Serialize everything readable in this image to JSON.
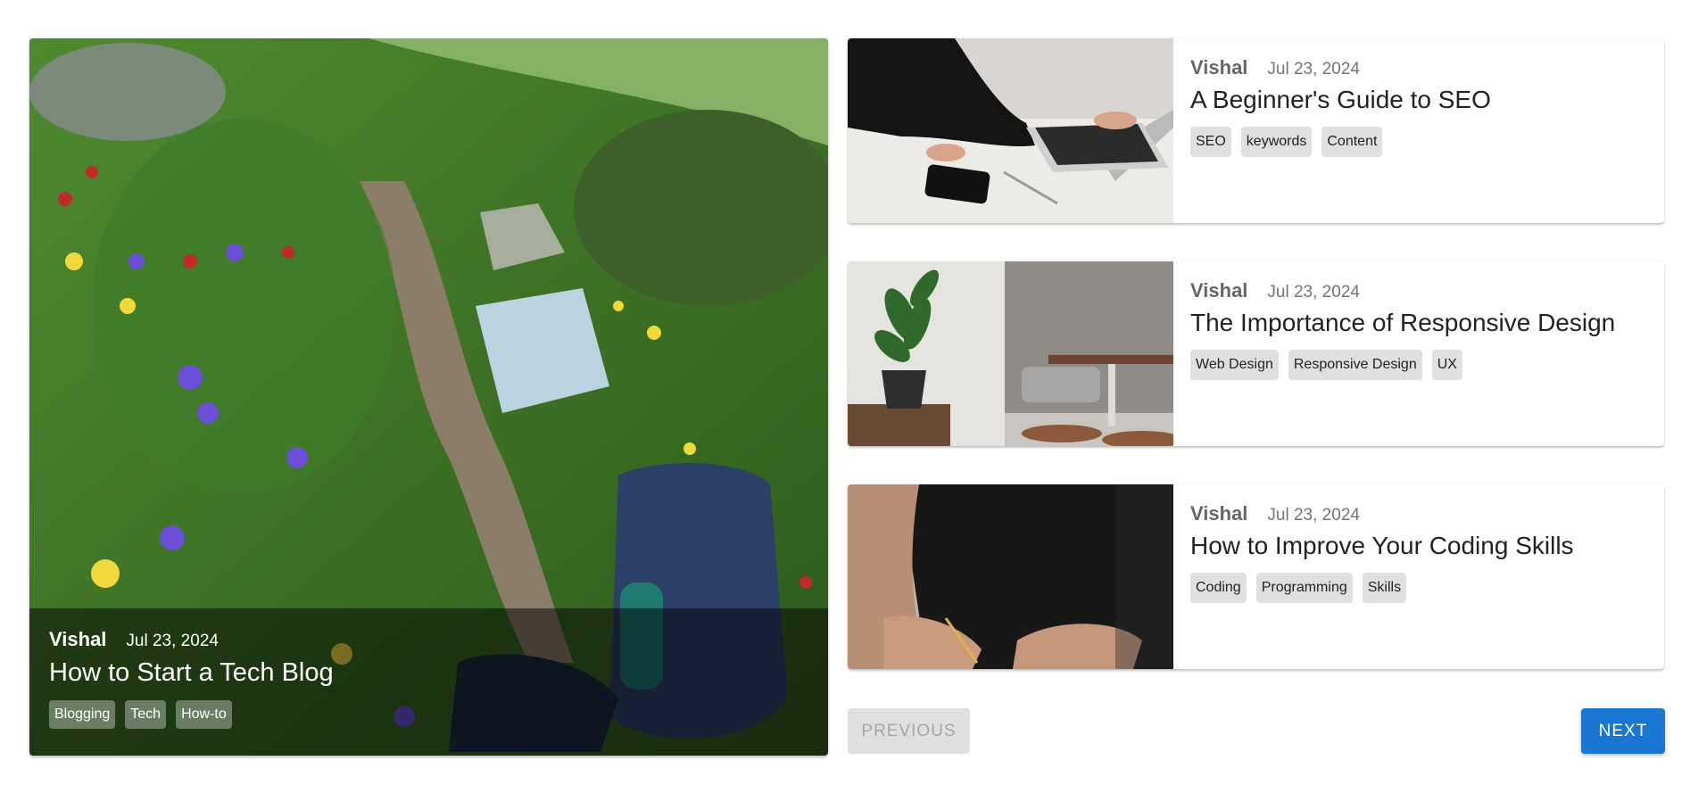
{
  "featured": {
    "author": "Vishal",
    "date": "Jul 23, 2024",
    "title": "How to Start a Tech Blog",
    "tags": [
      "Blogging",
      "Tech",
      "How-to"
    ]
  },
  "posts": [
    {
      "author": "Vishal",
      "date": "Jul 23, 2024",
      "title": "A Beginner's Guide to SEO",
      "tags": [
        "SEO",
        "keywords",
        "Content"
      ]
    },
    {
      "author": "Vishal",
      "date": "Jul 23, 2024",
      "title": "The Importance of Responsive Design",
      "tags": [
        "Web Design",
        "Responsive Design",
        "UX"
      ]
    },
    {
      "author": "Vishal",
      "date": "Jul 23, 2024",
      "title": "How to Improve Your Coding Skills",
      "tags": [
        "Coding",
        "Programming",
        "Skills"
      ]
    }
  ],
  "pagination": {
    "previous_label": "PREVIOUS",
    "next_label": "NEXT"
  },
  "colors": {
    "primary": "#1976d2",
    "disabled_bg": "#e0e0e0",
    "disabled_text": "#a6a6a6"
  }
}
